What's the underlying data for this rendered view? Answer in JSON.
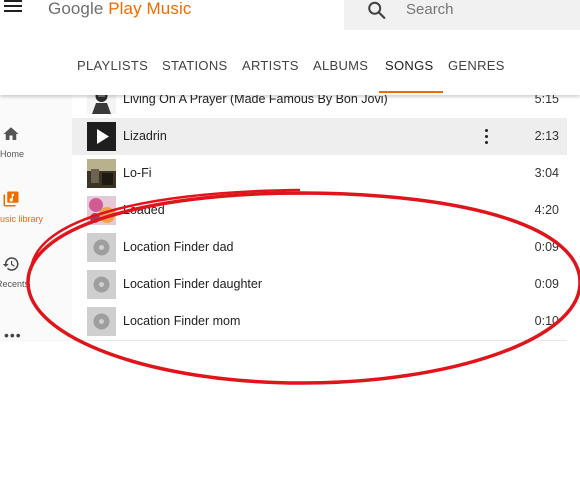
{
  "app": {
    "logo_google": "Google",
    "logo_product": " Play Music",
    "brand_color": "#ef6c00"
  },
  "search": {
    "placeholder": "Search"
  },
  "tabs": [
    {
      "label": "PLAYLISTS",
      "active": false
    },
    {
      "label": "STATIONS",
      "active": false
    },
    {
      "label": "ARTISTS",
      "active": false
    },
    {
      "label": "ALBUMS",
      "active": false
    },
    {
      "label": "SONGS",
      "active": true
    },
    {
      "label": "GENRES",
      "active": false
    }
  ],
  "sidenav": {
    "items": [
      {
        "label": "Home",
        "icon": "home-icon",
        "active": false
      },
      {
        "label": "usic library",
        "icon": "music-library-icon",
        "active": true
      },
      {
        "label": "Recents",
        "icon": "history-icon",
        "active": false
      }
    ],
    "more": "•••"
  },
  "songs": [
    {
      "title": "Living On A Prayer (Made Famous By Bon Jovi)",
      "duration": "5:15",
      "art": "album-art"
    },
    {
      "title": "Lizadrin",
      "duration": "2:13",
      "art": "play-icon",
      "selected": true
    },
    {
      "title": "Lo-Fi",
      "duration": "3:04",
      "art": "album-art"
    },
    {
      "title": "Loaded",
      "duration": "4:20",
      "art": "album-art"
    },
    {
      "title": "Location Finder dad",
      "duration": "0:09",
      "art": "default-album-icon"
    },
    {
      "title": "Location Finder daughter",
      "duration": "0:09",
      "art": "default-album-icon"
    },
    {
      "title": "Location Finder mom",
      "duration": "0:10",
      "art": "default-album-icon"
    }
  ],
  "annotation": {
    "shape": "ellipse",
    "color": "#e0151b"
  }
}
